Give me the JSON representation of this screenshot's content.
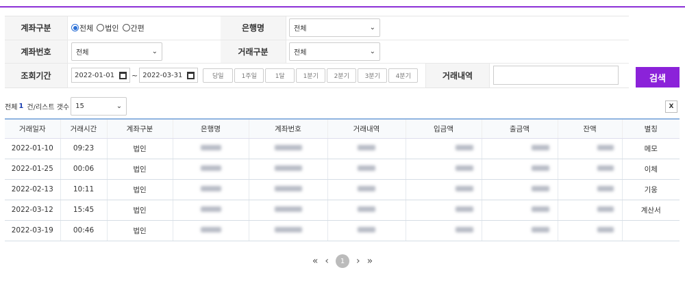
{
  "colors": {
    "accent": "#8b22d9"
  },
  "filter": {
    "account_type_label": "계좌구분",
    "account_type_options": [
      "전체",
      "법인",
      "간편"
    ],
    "account_type_selected": "전체",
    "bank_label": "은행명",
    "bank_value": "전체",
    "account_no_label": "계좌번호",
    "account_no_value": "전체",
    "trade_type_label": "거래구분",
    "trade_type_value": "전체",
    "period_label": "조회기간",
    "date_from": "2022-01-01",
    "date_sep": "~",
    "date_to": "2022-03-31",
    "period_buttons": [
      "당일",
      "1주일",
      "1달",
      "1분기",
      "2분기",
      "3분기",
      "4분기"
    ],
    "history_label": "거래내역",
    "history_value": "",
    "search_label": "검색"
  },
  "list": {
    "total_prefix": "전체",
    "total": "1",
    "suffix": "건/리스트 갯수",
    "page_size": "15",
    "excel_icon": "excel-icon"
  },
  "table": {
    "headers": [
      "거래일자",
      "거래시간",
      "계좌구분",
      "은행명",
      "계좌번호",
      "거래내역",
      "입금액",
      "출금액",
      "잔액",
      "별칭"
    ],
    "rows": [
      {
        "date": "2022-01-10",
        "time": "09:23",
        "type": "법인",
        "alias": "메모"
      },
      {
        "date": "2022-01-25",
        "time": "00:06",
        "type": "법인",
        "alias": "이체"
      },
      {
        "date": "2022-02-13",
        "time": "10:11",
        "type": "법인",
        "alias": "기웅"
      },
      {
        "date": "2022-03-12",
        "time": "15:45",
        "type": "법인",
        "alias": "계산서"
      },
      {
        "date": "2022-03-19",
        "time": "00:46",
        "type": "법인",
        "alias": ""
      }
    ]
  },
  "pager": {
    "first": "«",
    "prev": "‹",
    "current": "1",
    "next": "›",
    "last": "»"
  }
}
